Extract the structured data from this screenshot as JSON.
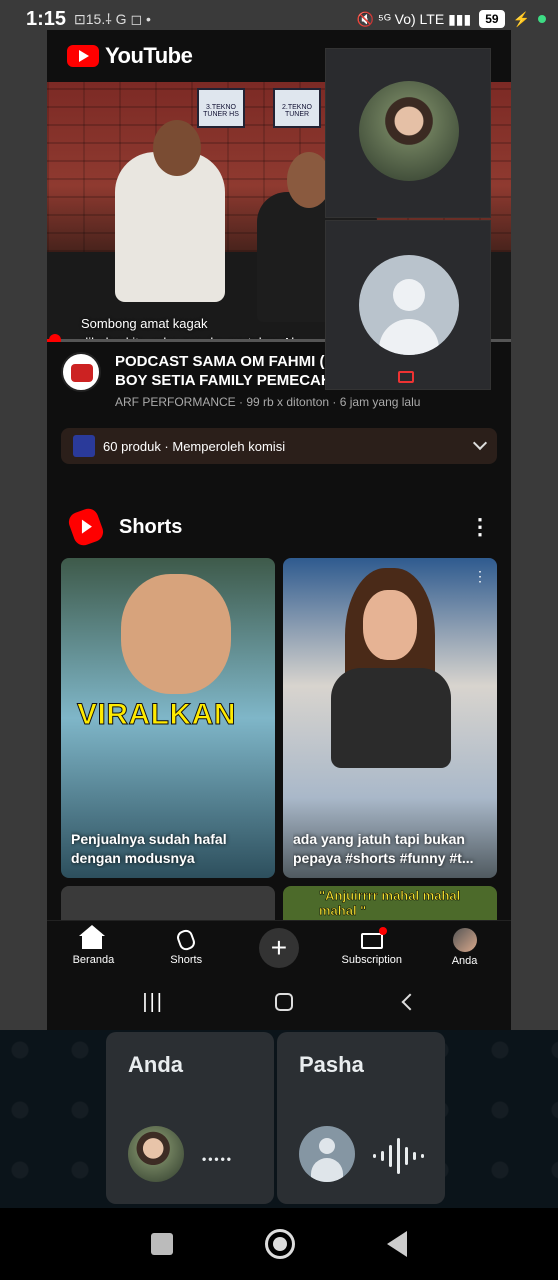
{
  "status_bar": {
    "time": "1:15",
    "left_icons": "⊡15.⸸ G ◻ •",
    "right_icons": "🔇 ⁵ᴳ Vo) LTE ▮▮▮",
    "battery": "59"
  },
  "youtube": {
    "logo_text": "YouTube",
    "video": {
      "subtitle_line1": "Sombong amat kagak",
      "subtitle_line2": "dibalas kita coba mau lawan tekno Ah",
      "poster1": "3.TEKNO TUNER HS",
      "poster2": "2.TEKNO TUNER",
      "progress_fraction": 0.02,
      "title": "PODCAST SAMA OM FAHMI ( BOY SETIA FAMILY PEMECAH",
      "title_line1": "PODCAST SAMA OM FAHMI (",
      "title_line2": "BOY SETIA FAMILY PEMECAH",
      "meta": "ARF PERFORMANCE · 99 rb x ditonton · 6 jam yang lalu"
    },
    "promo": {
      "text": "60 produk · Memperoleh komisi"
    },
    "shorts": {
      "section_title": "Shorts",
      "items": [
        {
          "overlay_text": "VIRALKAN",
          "caption_line1": "Penjualnya sudah hafal",
          "caption_line2": "dengan modusnya"
        },
        {
          "overlay_text": "",
          "caption_line1": "ada yang jatuh tapi bukan",
          "caption_line2": "pepaya #shorts #funny #t..."
        }
      ],
      "peek_text": "\"Anjuirrrr mahal mahal mahal \""
    },
    "bottom_nav": [
      {
        "label": "Beranda",
        "icon": "home-icon"
      },
      {
        "label": "Shorts",
        "icon": "shorts-icon"
      },
      {
        "label": "",
        "icon": "create-plus-icon"
      },
      {
        "label": "Subscription",
        "icon": "subscriptions-icon"
      },
      {
        "label": "Anda",
        "icon": "you-avatar-icon"
      }
    ],
    "create_symbol": "+"
  },
  "call": {
    "participants": [
      {
        "name": "Anda",
        "status": "•••••"
      },
      {
        "name": "Pasha",
        "status": "speaking"
      }
    ]
  },
  "colors": {
    "youtube_red": "#ff0000",
    "whatsapp_bg": "#0b141a",
    "tile_bg": "#2b2f33"
  }
}
